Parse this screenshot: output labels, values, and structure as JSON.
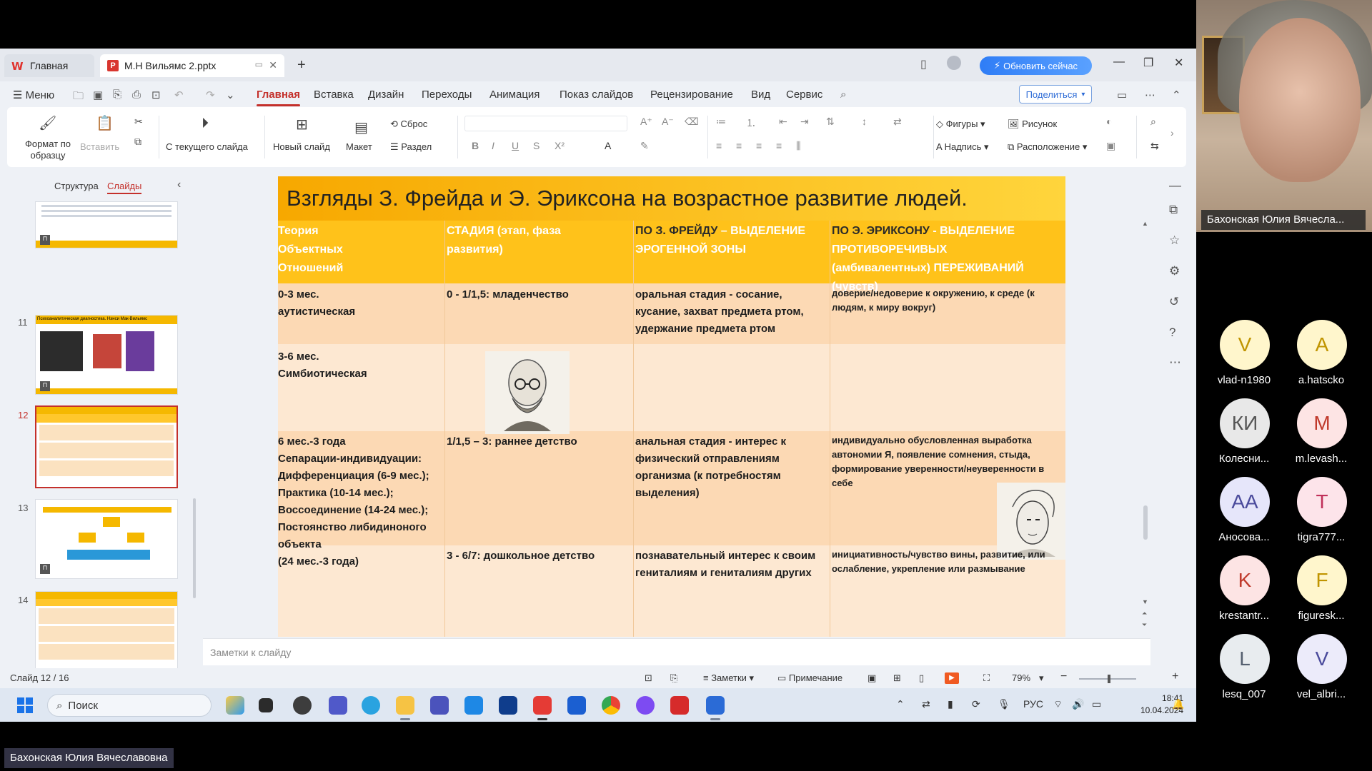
{
  "tabs": {
    "home": "Главная",
    "doc": "М.Н Вильямс 2.pptx"
  },
  "titlebar": {
    "update_label": "Обновить сейчас"
  },
  "menu": {
    "menu_label": "Меню",
    "items": [
      "Главная",
      "Вставка",
      "Дизайн",
      "Переходы",
      "Анимация",
      "Показ слайдов",
      "Рецензирование",
      "Вид",
      "Сервис"
    ],
    "share_label": "Поделиться"
  },
  "ribbon": {
    "format_painter": "Формат по образцу",
    "paste": "Вставить",
    "from_current": "С текущего слайда",
    "new_slide": "Новый слайд",
    "layout": "Макет",
    "reset": "Сброс",
    "section": "Раздел",
    "shapes": "Фигуры",
    "picture": "Рисунок",
    "textbox": "Надпись",
    "arrange": "Расположение"
  },
  "leftpanel": {
    "tab_outline": "Структура",
    "tab_slides": "Слайды",
    "slide_numbers": [
      "11",
      "12",
      "13",
      "14"
    ],
    "thumb11_title": "Психоаналитическая диагностика. Нэнси Мак-Вильямс"
  },
  "slide": {
    "title": "Взгляды З. Фрейда и Э. Эриксона на возрастное развитие людей.",
    "headers": {
      "c1": "Теория\nОбъектных\nОтношений",
      "c2": "СТАДИЯ (этап, фаза\nразвития)",
      "c3_dark": "ПО З. ФРЕЙДУ",
      "c3_rest": " – ВЫДЕЛЕНИЕ\nЭРОГЕННОЙ ЗОНЫ",
      "c4_dark": "ПО Э. ЭРИКСОНУ",
      "c4_rest": " - ВЫДЕЛЕНИЕ\nПРОТИВОРЕЧИВЫХ\n(амбивалентных) ПЕРЕЖИВАНИЙ\n(чувств)"
    },
    "rows": [
      {
        "c1": "0-3 мес.\nаутистическая",
        "c2": "0 - 1/1,5: младенчество",
        "c3": "оральная стадия - сосание,\nкусание, захват предмета ртом,\nудержание предмета ртом",
        "c4": "доверие/недоверие к окружению, к среде (к\nлюдям, к миру вокруг)"
      },
      {
        "c1": "3-6 мес.\nСимбиотическая",
        "c2": "",
        "c3": "",
        "c4": ""
      },
      {
        "c1": "6 мес.-3 года\nСепарации-индивидуации:\nДифференциация (6-9 мес.);\nПрактика (10-14 мес.);\nВоссоединение (14-24 мес.);\nПостоянство либидиноного\n объекта\n(24 мес.-3 года)",
        "c2": "1/1,5 – 3: раннее детство",
        "c3": "анальная стадия - интерес к\nфизический отправлениям\nорганизма (к потребностям\nвыделения)",
        "c4": "индивидуально обусловленная выработка\nавтономии Я, появление сомнения, стыда,\nформирование уверенности/неуверенности в\nсебе"
      },
      {
        "c1": "",
        "c2": "3 - 6/7: дошкольное детство",
        "c3": "познавательный интерес к своим\nгениталиям и гениталиям других",
        "c4": "инициативность/чувство вины, развитие, или\nослабление, укрепление или размывание"
      }
    ]
  },
  "notes": {
    "placeholder": "Заметки к слайду"
  },
  "status": {
    "slide_counter": "Слайд 12 / 16",
    "notes": "Заметки",
    "comment": "Примечание",
    "zoom": "79%"
  },
  "taskbar": {
    "search": "Поиск",
    "lang": "РУС",
    "time": "18:41",
    "date": "10.04.2024"
  },
  "video": {
    "speaker_name": "Бахонская Юлия Вячесла..."
  },
  "participants": [
    {
      "initials": "V",
      "name": "vlad-n1980",
      "bg": "#fff6cc",
      "fg": "#c09400"
    },
    {
      "initials": "A",
      "name": "a.hatscko",
      "bg": "#fff6cc",
      "fg": "#c09400"
    },
    {
      "initials": "КИ",
      "name": "Колесни...",
      "bg": "#e8e8e8",
      "fg": "#555555"
    },
    {
      "initials": "M",
      "name": "m.levash...",
      "bg": "#fde4e4",
      "fg": "#c0392b"
    },
    {
      "initials": "АА",
      "name": "Аносова...",
      "bg": "#e6e6fa",
      "fg": "#4b4b9c"
    },
    {
      "initials": "T",
      "name": "tigra777...",
      "bg": "#fde4ea",
      "fg": "#c0305a"
    },
    {
      "initials": "K",
      "name": "krestantr...",
      "bg": "#fde4e4",
      "fg": "#c0392b"
    },
    {
      "initials": "F",
      "name": "figuresk...",
      "bg": "#fff6cc",
      "fg": "#c09400"
    },
    {
      "initials": "L",
      "name": "lesq_007",
      "bg": "#e8ecef",
      "fg": "#556070"
    },
    {
      "initials": "V",
      "name": "vel_albri...",
      "bg": "#ecebfa",
      "fg": "#4b4b9c"
    }
  ],
  "bottom_name": "Бахонская Юлия Вячеславовна"
}
